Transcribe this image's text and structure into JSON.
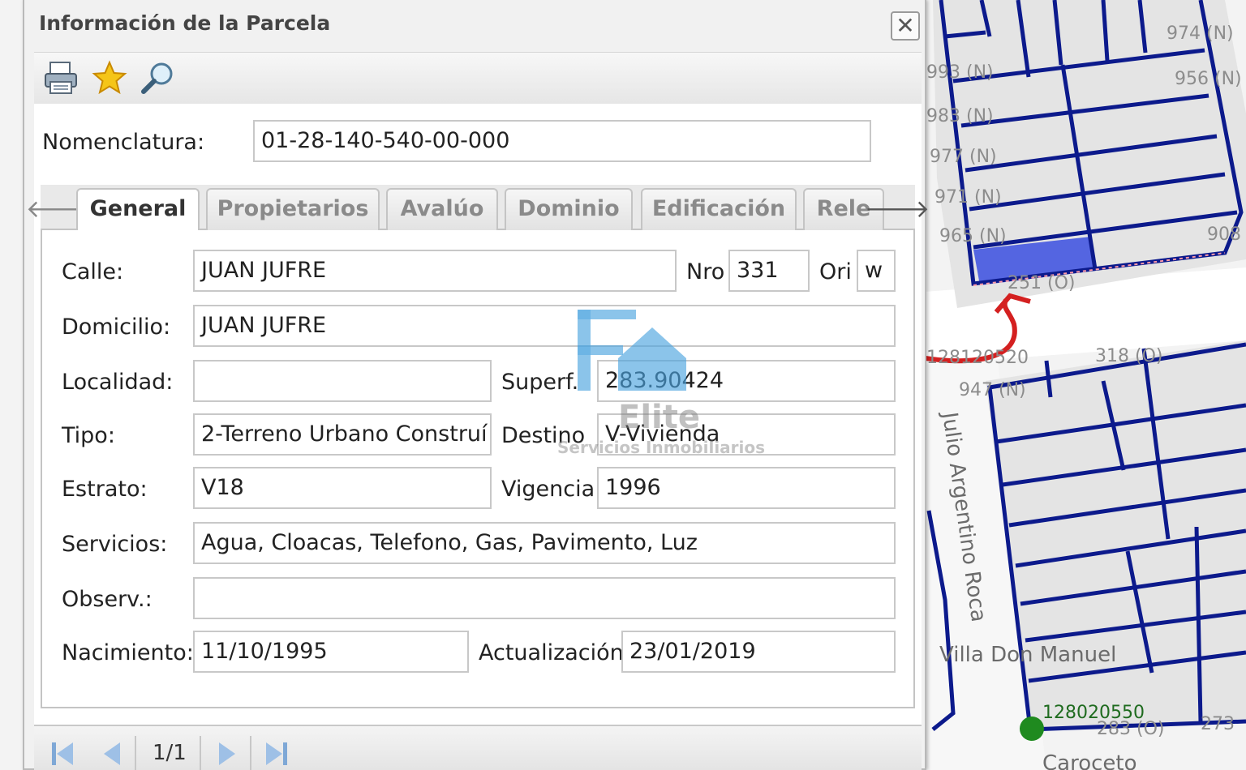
{
  "panel": {
    "title": "Información de la Parcela",
    "close_symbol": "✕"
  },
  "toolbar": {
    "icons": [
      "printer-icon",
      "star-icon",
      "magnifier-icon"
    ]
  },
  "nomenclatura": {
    "label": "Nomenclatura:",
    "value": "01-28-140-540-00-000"
  },
  "tabs": {
    "items": [
      "General",
      "Propietarios",
      "Avalúo",
      "Dominio",
      "Edificación",
      "Rele"
    ],
    "active": "General",
    "left_arrow": "🡐",
    "right_arrow": "🡒"
  },
  "form": {
    "calle": {
      "label": "Calle:",
      "value": "JUAN JUFRE"
    },
    "nro": {
      "label": "Nro",
      "value": "331"
    },
    "ori": {
      "label": "Ori",
      "value": "w"
    },
    "domicilio": {
      "label": "Domicilio:",
      "value": "JUAN JUFRE"
    },
    "localidad": {
      "label": "Localidad:",
      "value": ""
    },
    "superf": {
      "label": "Superf.",
      "value": "283.90424"
    },
    "tipo": {
      "label": "Tipo:",
      "value": "2-Terreno Urbano Construí"
    },
    "destino": {
      "label": "Destino",
      "value": "V-Vivienda"
    },
    "estrato": {
      "label": "Estrato:",
      "value": "V18"
    },
    "vigencia": {
      "label": "Vigencia",
      "value": "1996"
    },
    "servicios": {
      "label": "Servicios:",
      "value": "Agua, Cloacas, Telefono, Gas, Pavimento, Luz"
    },
    "observ": {
      "label": "Observ.:",
      "value": ""
    },
    "nacimiento": {
      "label": "Nacimiento:",
      "value": "11/10/1995"
    },
    "actualizacion": {
      "label": "Actualización",
      "value": "23/01/2019"
    }
  },
  "pager": {
    "page_text": "1/1"
  },
  "watermark": {
    "word": "Elite",
    "sub": "Servicios Inmobiliarios"
  },
  "map": {
    "labels_top": [
      "974 (N)",
      "993 (N)",
      "956 (N)",
      "983 (N)",
      "977 (N)",
      "971 (N)",
      "965 (N)",
      "908",
      "251 (O)"
    ],
    "labels_bottom": [
      "128120520",
      "318 (O)",
      "947 (N)",
      "128020550",
      "283 (O)",
      "273"
    ],
    "streets": [
      "Julio Argentino Roca",
      "Villa Don Manuel",
      "Caroceto"
    ],
    "colors": {
      "lot_line": "#0c1a8c",
      "highlight": "#3b4fe0",
      "arrow": "#d42020",
      "marker": "#1f8a1f",
      "block": "#e9e9e9"
    }
  }
}
